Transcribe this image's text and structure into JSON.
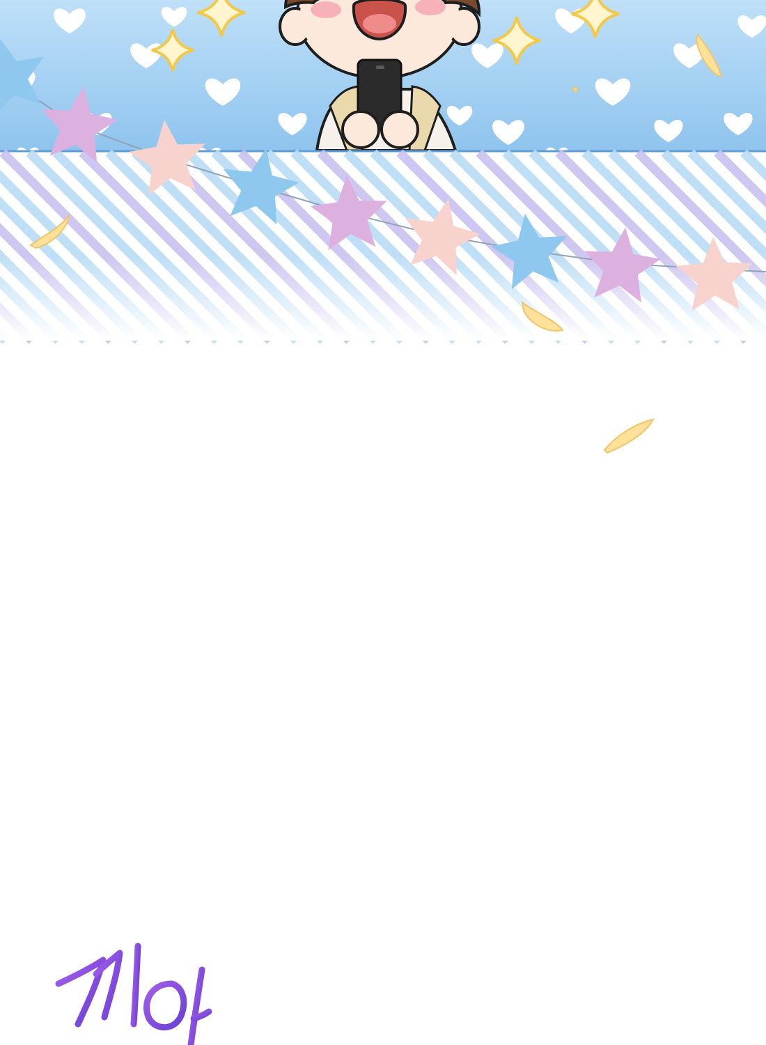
{
  "panel": {
    "sfx_text": "꺄아",
    "colors": {
      "sky_top": "#bfe0f8",
      "sky_bottom": "#8fc4ee",
      "heart": "#ffffff",
      "sparkle": "#f2c94c",
      "stripe_blue": "#b9dcf6",
      "stripe_lavender": "#c9c2f0",
      "star_pink": "#dcb1e0",
      "star_peach": "#f8d2cc",
      "star_blue": "#8fc8ee",
      "confetti": "#ffe19a",
      "sfx_purple": "#8a4de0",
      "outline": "#1e1e1e",
      "skin": "#fde8dc",
      "hair": "#7a4a2c",
      "sweater": "#ead9ad",
      "phone": "#2b2b2b"
    },
    "icons": [
      "heart-icon",
      "sparkle-icon",
      "star-icon",
      "confetti-icon",
      "phone-icon"
    ]
  }
}
